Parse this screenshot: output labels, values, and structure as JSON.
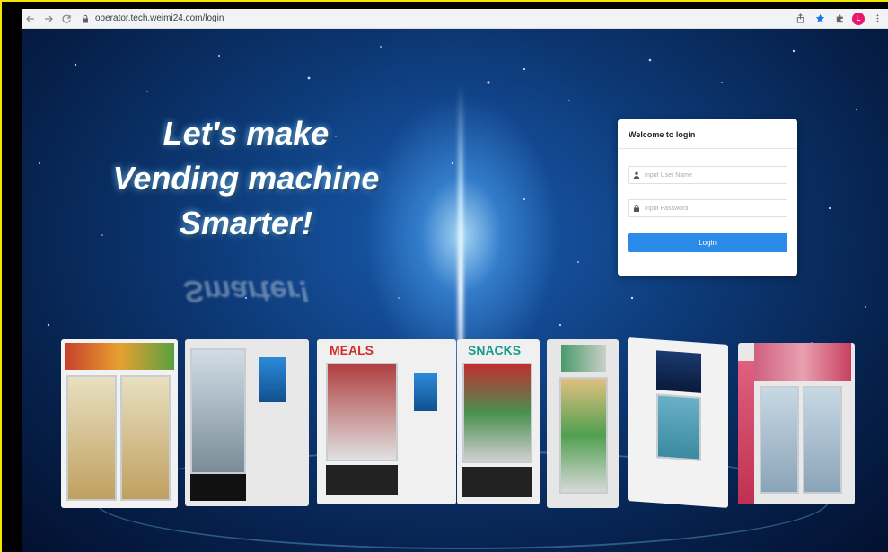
{
  "browser": {
    "url": "operator.tech.weimi24.com/login",
    "avatar_letter": "L",
    "icons": [
      "back-icon",
      "forward-icon",
      "reload-icon",
      "lock-icon",
      "share-icon",
      "bookmark-star-icon",
      "extensions-icon",
      "menu-icon"
    ]
  },
  "hero": {
    "line1": "Let's make",
    "line2": "Vending machine",
    "line3": "Smarter!",
    "reflection": "Smarter!"
  },
  "login": {
    "title": "Welcome to login",
    "username_placeholder": "Input User Name",
    "password_placeholder": "Input Password",
    "button_label": "Login"
  },
  "machines": {
    "meals_label": "MEALS",
    "snacks_label": "SNACKS"
  },
  "colors": {
    "accent": "#2a8ce8",
    "avatar": "#e8176b",
    "frame": "#f3e600"
  }
}
